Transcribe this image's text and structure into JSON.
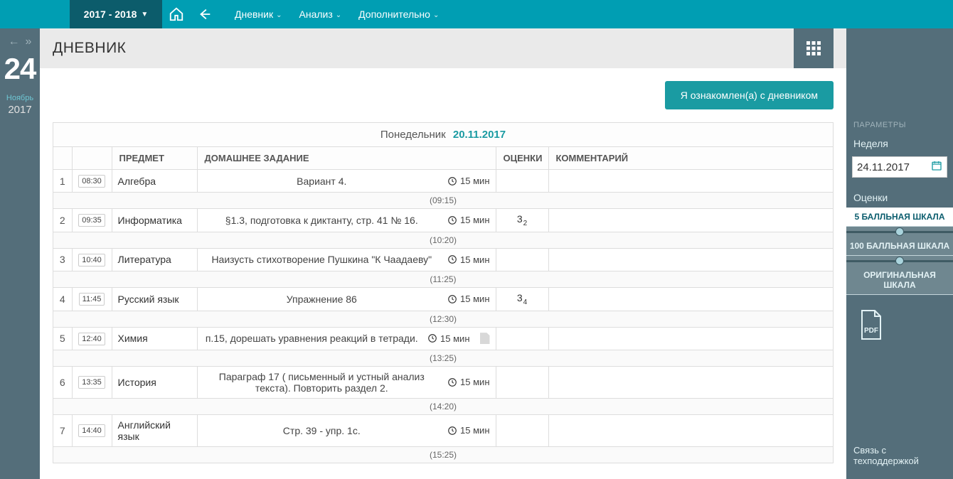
{
  "nav": {
    "year_range": "2017 - 2018",
    "items": [
      "Дневник",
      "Анализ",
      "Дополнительно"
    ]
  },
  "left": {
    "day": "24",
    "month": "Ноябрь",
    "year": "2017"
  },
  "header": {
    "title": "ДНЕВНИК"
  },
  "ack_button": "Я ознакомлен(а) с дневником",
  "day_header": {
    "dow": "Понедельник",
    "date": "20.11.2017"
  },
  "columns": {
    "subject": "ПРЕДМЕТ",
    "homework": "ДОМАШНЕЕ ЗАДАНИЕ",
    "grades": "ОЦЕНКИ",
    "comment": "КОММЕНТАРИЙ"
  },
  "lessons": [
    {
      "n": "1",
      "time": "08:30",
      "subject": "Алгебра",
      "hw": "Вариант 4.",
      "dur": "15 мин",
      "grade": "",
      "sub": "",
      "file": false,
      "break": "(09:15)"
    },
    {
      "n": "2",
      "time": "09:35",
      "subject": "Информатика",
      "hw": "§1.3, подготовка к диктанту, стр. 41 № 16.",
      "dur": "15 мин",
      "grade": "3",
      "sub": "2",
      "file": false,
      "break": "(10:20)"
    },
    {
      "n": "3",
      "time": "10:40",
      "subject": "Литература",
      "hw": "Наизусть стихотворение Пушкина \"К Чаадаеву\"",
      "dur": "15 мин",
      "grade": "",
      "sub": "",
      "file": false,
      "break": "(11:25)"
    },
    {
      "n": "4",
      "time": "11:45",
      "subject": "Русский язык",
      "hw": "Упражнение 86",
      "dur": "15 мин",
      "grade": "3",
      "sub": "4",
      "file": false,
      "break": "(12:30)"
    },
    {
      "n": "5",
      "time": "12:40",
      "subject": "Химия",
      "hw": "п.15, дорешать уравнения реакций в тетради.",
      "dur": "15 мин",
      "grade": "",
      "sub": "",
      "file": true,
      "break": "(13:25)"
    },
    {
      "n": "6",
      "time": "13:35",
      "subject": "История",
      "hw": "Параграф 17 ( письменный и устный анализ текста). Повторить раздел 2.",
      "dur": "15 мин",
      "grade": "",
      "sub": "",
      "file": false,
      "break": "(14:20)"
    },
    {
      "n": "7",
      "time": "14:40",
      "subject": "Английский язык",
      "hw": "Стр. 39 - упр. 1с.",
      "dur": "15 мин",
      "grade": "",
      "sub": "",
      "file": false,
      "break": "(15:25)"
    }
  ],
  "right": {
    "params_label": "ПАРАМЕТРЫ",
    "week_label": "Неделя",
    "week_date": "24.11.2017",
    "grades_label": "Оценки",
    "scale5": "5 БАЛЛЬНАЯ ШКАЛА",
    "scale100": "100 БАЛЛЬНАЯ ШКАЛА",
    "scale_orig": "ОРИГИНАЛЬНАЯ ШКАЛА",
    "pdf": "PDF",
    "support": "Связь с техподдержкой"
  }
}
